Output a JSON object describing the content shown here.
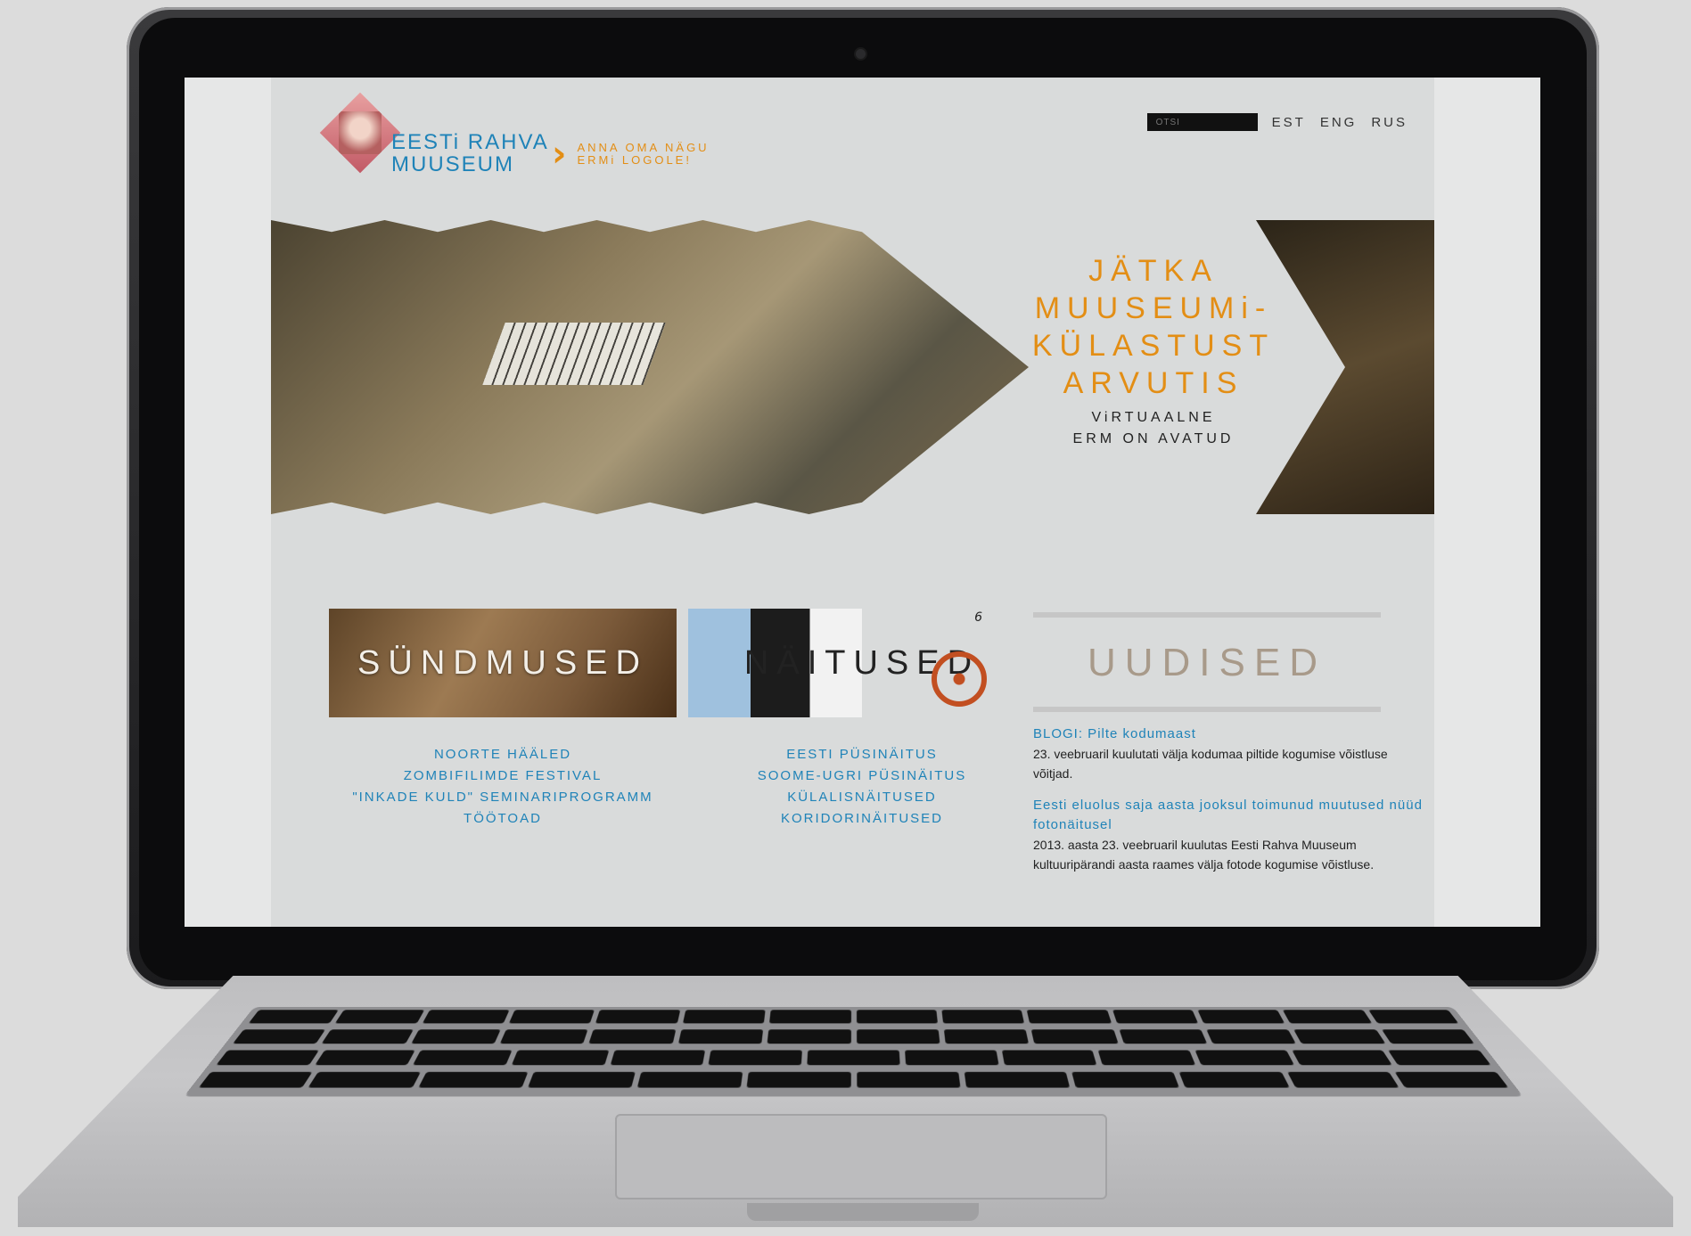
{
  "header": {
    "logo_line1": "EESTi RAHVA",
    "logo_line2": "MUUSEUM",
    "promo_line1": "ANNA OMA NÄGU",
    "promo_line2": "ERMi LOGOLE!",
    "search_placeholder": "OTSI",
    "languages": [
      "EST",
      "ENG",
      "RUS"
    ]
  },
  "hero": {
    "title_lines": [
      "JÄTKA",
      "MUUSEUMi-",
      "KÜLASTUST",
      "ARVUTIS"
    ],
    "subtitle_lines": [
      "ViRTUAALNE",
      "ERM ON AVATUD"
    ]
  },
  "tiles": {
    "events_label": "SÜNDMUSED",
    "exhibitions_label": "NÄITUSED",
    "exhibitions_number": "6"
  },
  "events_links": [
    "NOORTE HÄÄLED",
    "ZOMBIFILIMDE FESTIVAL",
    "\"INKADE KULD\" SEMINARIPROGRAMM",
    "TÖÖTOAD"
  ],
  "exhibition_links": [
    "EESTI PÜSINÄITUS",
    "SOOME-UGRI PÜSINÄITUS",
    "KÜLALISNÄITUSED",
    "KORIDORINÄITUSED"
  ],
  "news": {
    "title": "UUDISED",
    "items": [
      {
        "headline": "BLOGI: Pilte kodumaast",
        "body": "23. veebruaril kuulutati välja kodumaa piltide kogumise võistluse võitjad."
      },
      {
        "headline": "Eesti eluolus saja aasta jooksul toimunud muutused nüüd fotonäitusel",
        "body": "2013. aasta 23. veebruaril kuulutas Eesti Rahva Muuseum kultuuripärandi aasta raames välja fotode kogumise võistluse."
      }
    ]
  },
  "colors": {
    "accent_orange": "#e38e15",
    "link_blue": "#1f83b8",
    "background": "#d9dbdb"
  }
}
